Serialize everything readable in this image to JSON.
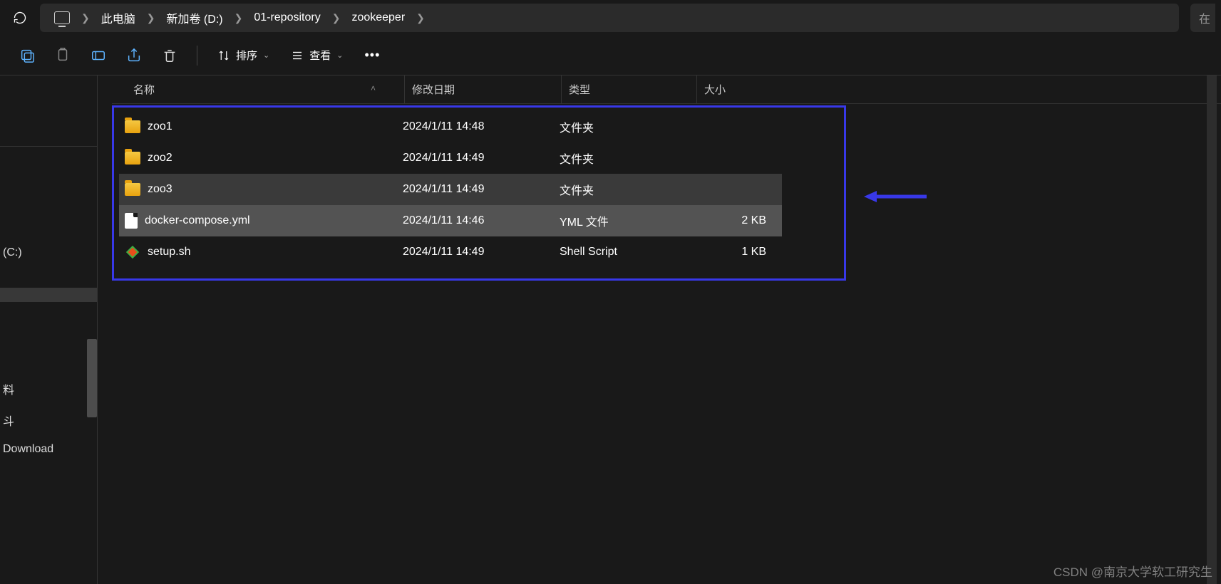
{
  "breadcrumb": {
    "items": [
      "此电脑",
      "新加卷 (D:)",
      "01-repository",
      "zookeeper"
    ]
  },
  "search_stub": "在",
  "toolbar": {
    "sort_label": "排序",
    "view_label": "查看"
  },
  "columns": {
    "name": "名称",
    "date": "修改日期",
    "type": "类型",
    "size": "大小"
  },
  "files": [
    {
      "name": "zoo1",
      "date": "2024/1/11 14:48",
      "type": "文件夹",
      "size": "",
      "icon": "folder",
      "state": ""
    },
    {
      "name": "zoo2",
      "date": "2024/1/11 14:49",
      "type": "文件夹",
      "size": "",
      "icon": "folder",
      "state": ""
    },
    {
      "name": "zoo3",
      "date": "2024/1/11 14:49",
      "type": "文件夹",
      "size": "",
      "icon": "folder",
      "state": "hover"
    },
    {
      "name": "docker-compose.yml",
      "date": "2024/1/11 14:46",
      "type": "YML 文件",
      "size": "2 KB",
      "icon": "doc",
      "state": "selected"
    },
    {
      "name": "setup.sh",
      "date": "2024/1/11 14:49",
      "type": "Shell Script",
      "size": "1 KB",
      "icon": "sh",
      "state": ""
    }
  ],
  "sidebar": {
    "items": [
      "(C:)",
      "",
      "",
      "料",
      "斗",
      "Download"
    ],
    "selected_index": 1
  },
  "watermark": "CSDN @南京大学软工研究生"
}
